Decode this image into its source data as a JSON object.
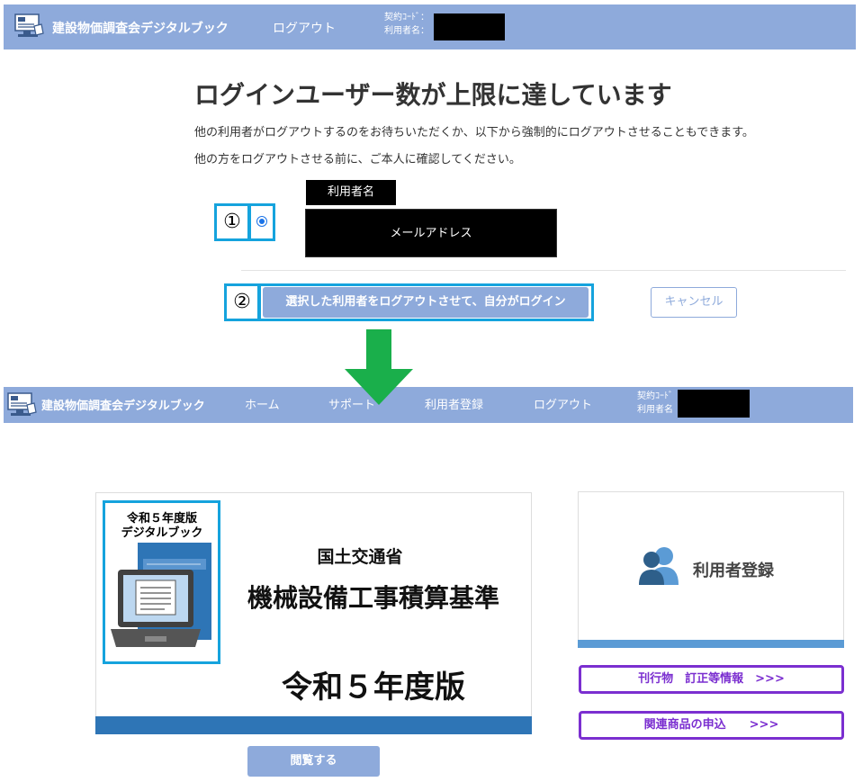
{
  "header1": {
    "brand": "建設物価調査会デジタルブック",
    "logout": "ログアウト",
    "contract_code_label": "契約ｺｰﾄﾞ：",
    "user_name_label": "利用者名："
  },
  "main": {
    "title": "ログインユーザー数が上限に達しています",
    "desc1": "他の利用者がログアウトするのをお待ちいただくか、以下から強制的にログアウトさせることもできます。",
    "desc2": "他の方をログアウトさせる前に、ご本人に確認してください。",
    "step1": "①",
    "step2": "②",
    "user_label": "利用者名",
    "email_label": "メールアドレス",
    "force_logout_button": "選択した利用者をログアウトさせて、自分がログイン",
    "cancel_button": "キャンセル"
  },
  "header2": {
    "brand": "建設物価調査会デジタルブック",
    "nav": [
      "ホーム",
      "サポート",
      "利用者登録",
      "ログアウト"
    ],
    "contract_code_label": "契約ｺｰﾄﾞ",
    "user_name_label": "利用者名"
  },
  "book": {
    "cover_title_line1": "令和５年度版",
    "cover_title_line2": "デジタルブック",
    "org": "国土交通省",
    "name": "機械設備工事積算基準",
    "year": "令和５年度版",
    "view_button": "閲覧する"
  },
  "side": {
    "register": "利用者登録",
    "errata": "刊行物　訂正等情報　>>>",
    "related": "関連商品の申込　　>>>"
  },
  "colors": {
    "header": "#8eaadb",
    "highlight": "#15a3dd",
    "arrow": "#1aaf4b",
    "book_bar": "#2e75b6",
    "purple": "#7b2fd0"
  },
  "icons": [
    "computer-book-icon",
    "down-arrow-icon",
    "users-icon",
    "laptop-icon"
  ]
}
